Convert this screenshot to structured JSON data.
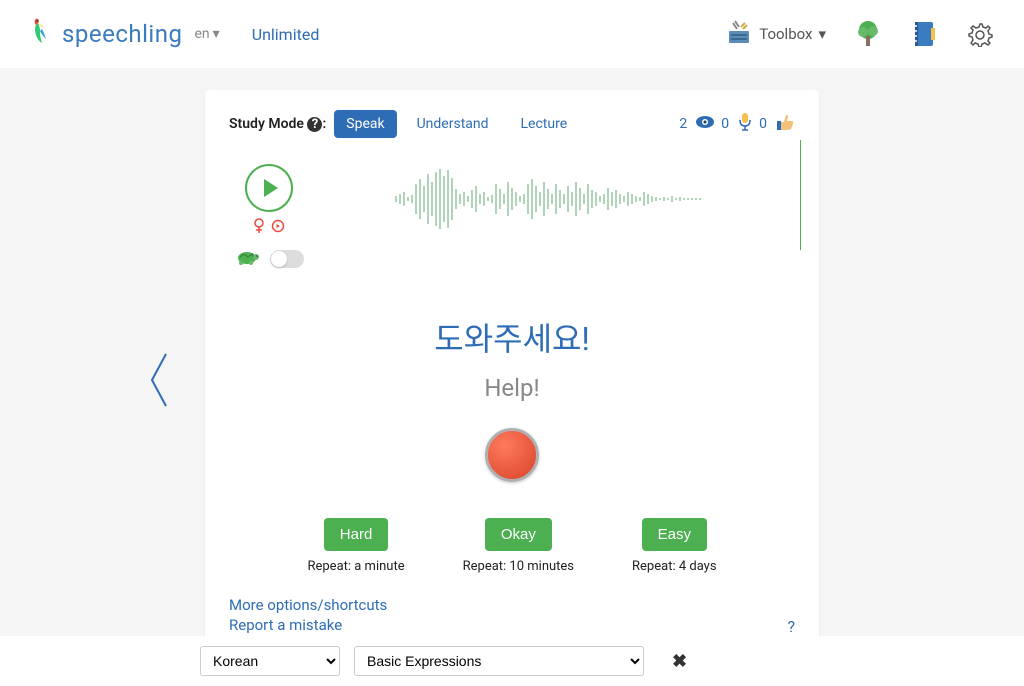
{
  "header": {
    "brand": "speechling",
    "lang_selector": "en",
    "plan": "Unlimited",
    "toolbox_label": "Toolbox"
  },
  "study": {
    "label": "Study Mode",
    "modes": {
      "speak": "Speak",
      "understand": "Understand",
      "lecture": "Lecture"
    },
    "stats": {
      "views": "2",
      "records": "0",
      "likes": "0"
    }
  },
  "phrase": {
    "target": "도와주세요!",
    "translation": "Help!"
  },
  "difficulty": {
    "hard": {
      "label": "Hard",
      "repeat": "Repeat: a minute"
    },
    "okay": {
      "label": "Okay",
      "repeat": "Repeat: 10 minutes"
    },
    "easy": {
      "label": "Easy",
      "repeat": "Repeat: 4 days"
    }
  },
  "links": {
    "more": "More options/shortcuts",
    "report": "Report a mistake",
    "help": "?"
  },
  "footer": {
    "language": "Korean",
    "category": "Basic Expressions"
  }
}
